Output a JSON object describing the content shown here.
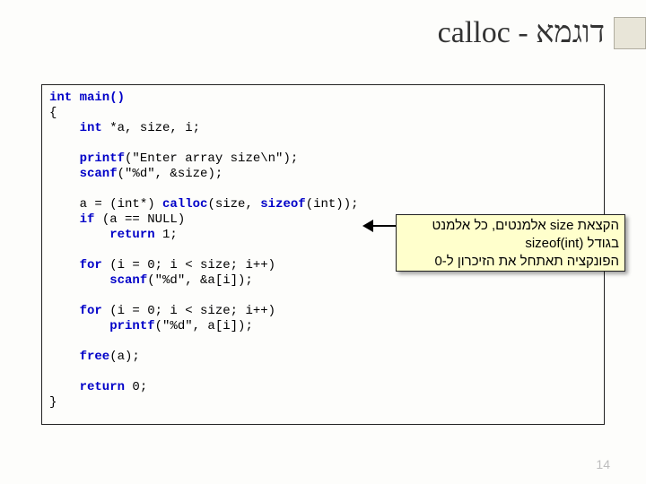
{
  "title": "calloc - דוגמא",
  "code": {
    "l1": "int main()",
    "l2": "{",
    "l3_pre": "    int ",
    "l3_body": "*a, size, i;",
    "l4_pre": "    printf",
    "l4_body": "(\"Enter array size\\n\");",
    "l5_pre": "    scanf",
    "l5_body": "(\"%d\", &size);",
    "l6_pre": "    a = (int*) ",
    "l6_call": "calloc",
    "l6_args_open": "(size, ",
    "l6_sizeof": "sizeof",
    "l6_args_close": "(int));",
    "l7_pre": "    if ",
    "l7_body": "(a == NULL)",
    "l8_pre": "        return ",
    "l8_body": "1;",
    "l9_pre": "    for ",
    "l9_body": "(i = 0; i < size; i++)",
    "l10_pre": "        scanf",
    "l10_body": "(\"%d\", &a[i]);",
    "l11_pre": "    for ",
    "l11_body": "(i = 0; i < size; i++)",
    "l12_pre": "        printf",
    "l12_body": "(\"%d\", a[i]);",
    "l13_pre": "    free",
    "l13_body": "(a);",
    "l14_pre": "    return ",
    "l14_body": "0;",
    "l15": "}"
  },
  "annotation": {
    "line1": "הקצאת size אלמנטים, כל אלמנט",
    "line2": "בגודל sizeof(int)",
    "line3": "הפונקציה תאתחל את הזיכרון ל-0"
  },
  "page_number": "14"
}
